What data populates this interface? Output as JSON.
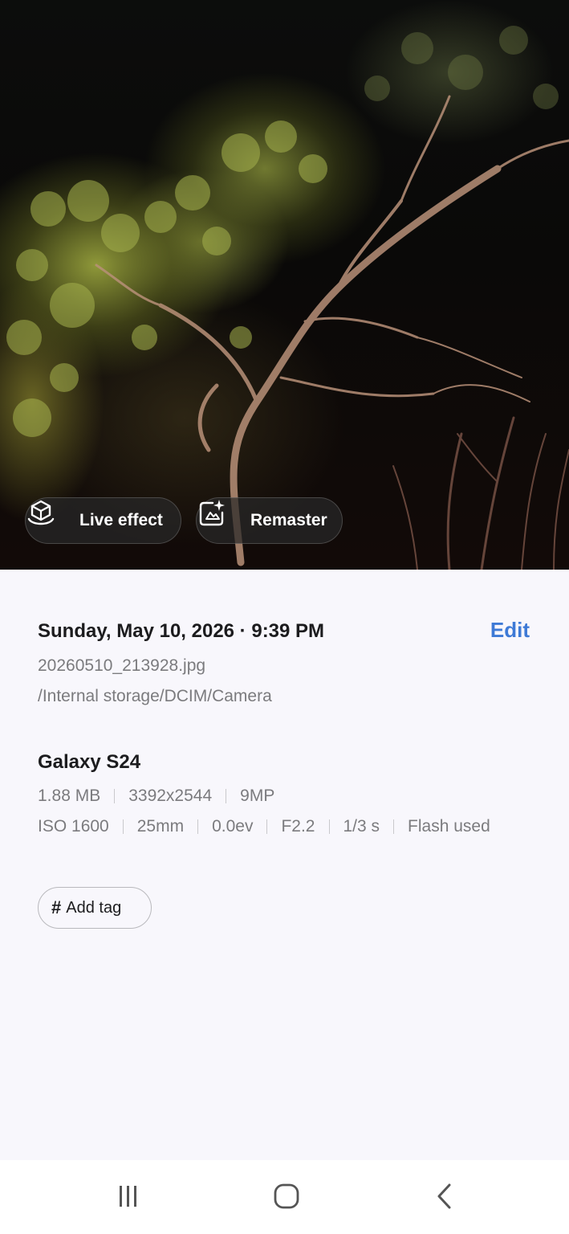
{
  "photo": {
    "live_effect_label": "Live effect",
    "remaster_label": "Remaster"
  },
  "details": {
    "date_time": "Sunday, May 10, 2026 · 9:39 PM",
    "edit_label": "Edit",
    "filename": "20260510_213928.jpg",
    "path": "/Internal storage/DCIM/Camera",
    "device": "Galaxy S24",
    "size": "1.88 MB",
    "resolution": "3392x2544",
    "megapixels": "9MP",
    "iso": "ISO 1600",
    "focal_length": "25mm",
    "exposure_value": "0.0ev",
    "aperture": "F2.2",
    "shutter": "1/3 s",
    "flash": "Flash used",
    "add_tag_label": "Add tag",
    "add_tag_icon_glyph": "#"
  },
  "icons": {
    "live_effect": "cube-hand-icon",
    "remaster": "sparkle-frame-icon",
    "recents": "recents-icon",
    "home": "home-icon",
    "back": "back-icon"
  },
  "colors": {
    "accent": "#3e7ad6",
    "background": "#f8f7fc",
    "primary_text": "#1c1c1e",
    "secondary_text": "#7b7b7e"
  }
}
